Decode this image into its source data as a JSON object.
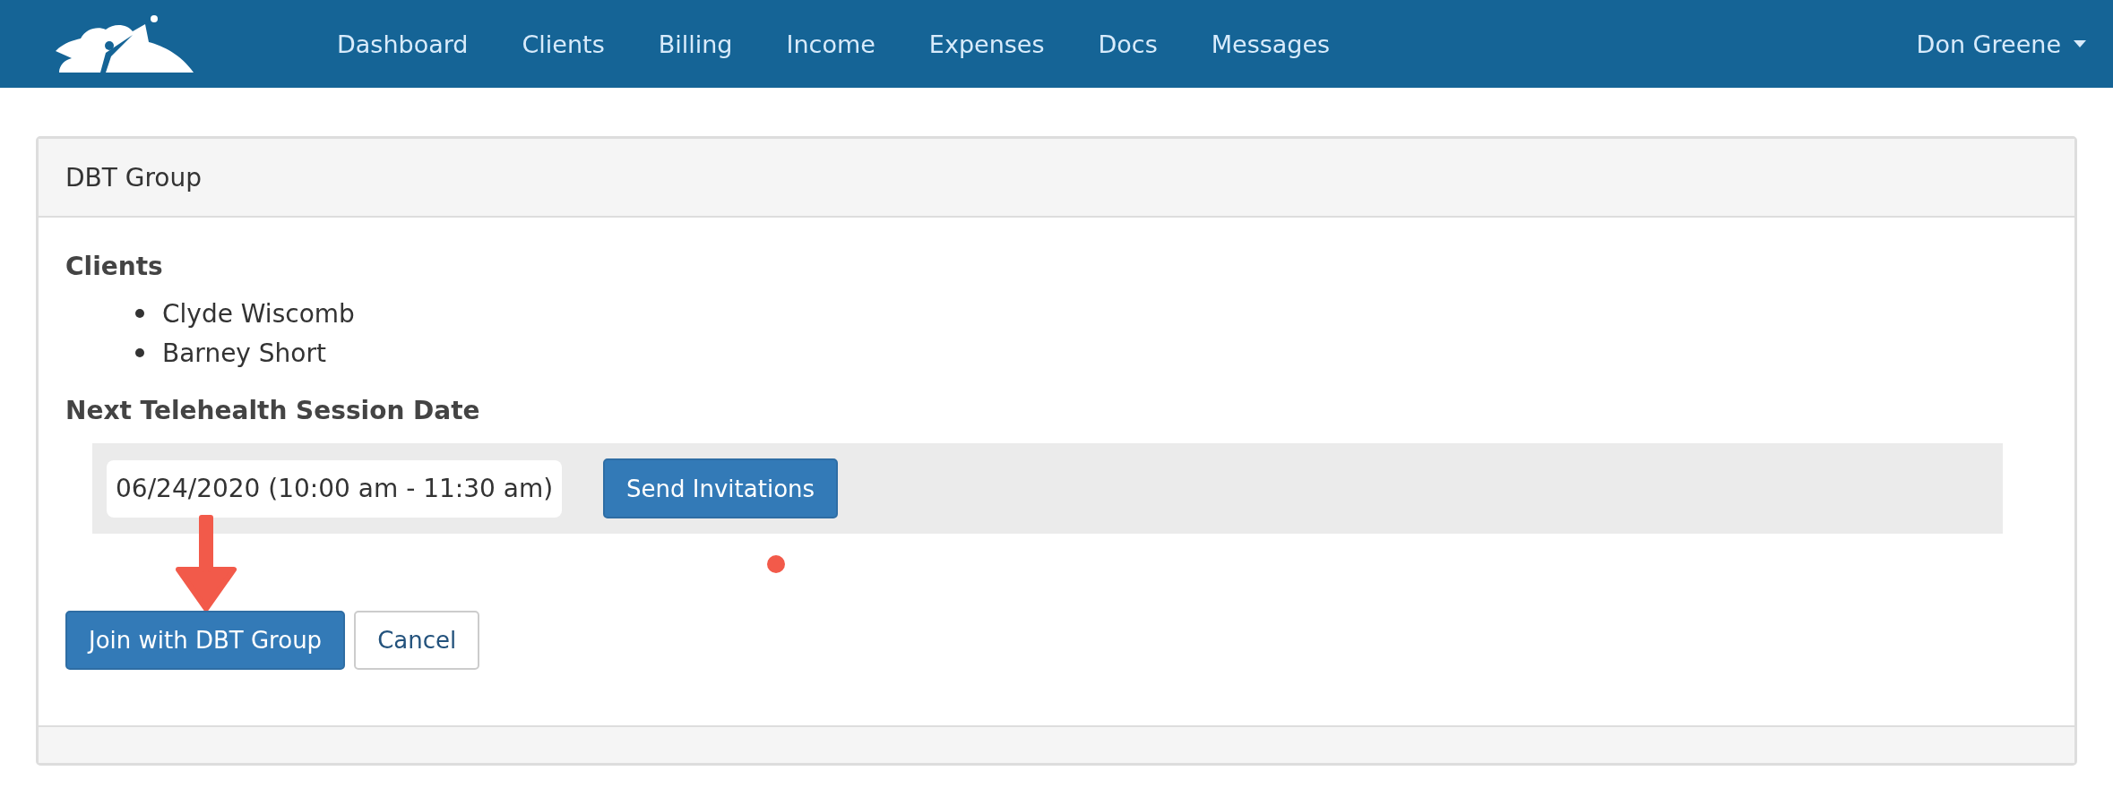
{
  "navbar": {
    "menu": [
      {
        "label": "Dashboard"
      },
      {
        "label": "Clients"
      },
      {
        "label": "Billing"
      },
      {
        "label": "Income"
      },
      {
        "label": "Expenses"
      },
      {
        "label": "Docs"
      },
      {
        "label": "Messages"
      }
    ],
    "user": "Don Greene"
  },
  "panel": {
    "title": "DBT Group",
    "clients_heading": "Clients",
    "clients": [
      "Clyde Wiscomb",
      "Barney Short"
    ],
    "session_heading": "Next Telehealth Session Date",
    "session_date": "06/24/2020 (10:00 am - 11:30 am)",
    "send_button": "Send Invitations",
    "buttons": [
      {
        "label": "Join with DBT Group",
        "kind": "primary"
      },
      {
        "label": "Cancel",
        "kind": "default"
      }
    ]
  }
}
